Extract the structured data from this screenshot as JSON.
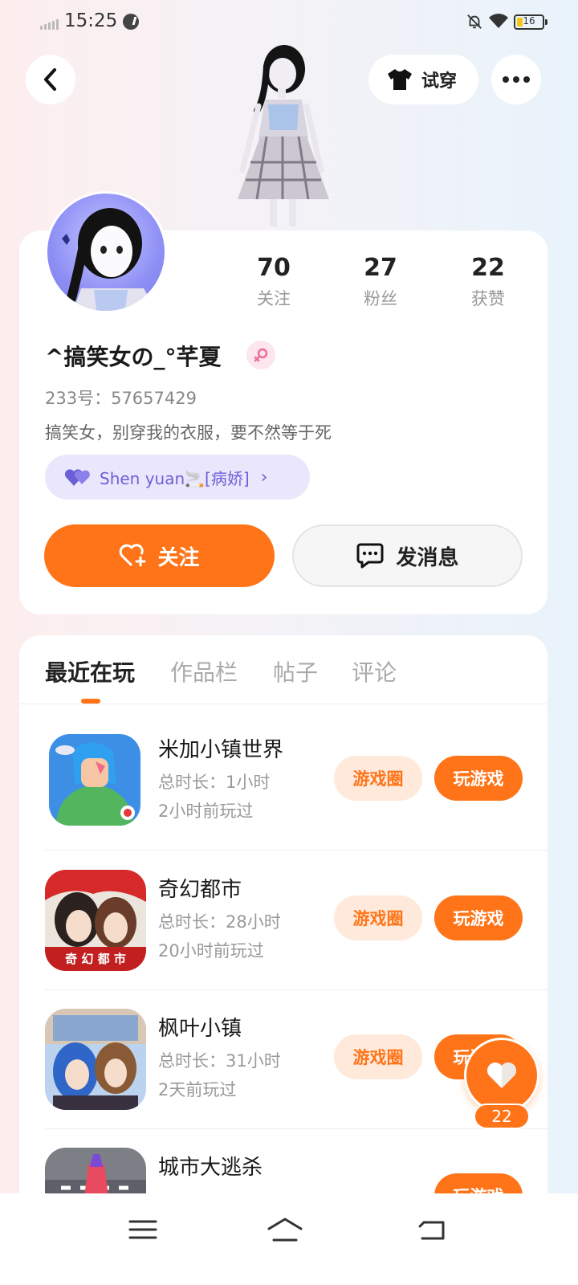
{
  "status_bar": {
    "time": "15:25",
    "battery": "16",
    "icons": [
      "signal-icon",
      "app-notification-icon",
      "bell-muted-icon",
      "wifi-icon",
      "battery-icon"
    ]
  },
  "header": {
    "tryon_label": "试穿",
    "icons": [
      "back-arrow-icon",
      "tshirt-icon",
      "more-icon"
    ]
  },
  "profile": {
    "stats": [
      {
        "value": "70",
        "label": "关注"
      },
      {
        "value": "27",
        "label": "粉丝"
      },
      {
        "value": "22",
        "label": "获赞"
      }
    ],
    "username": "^搞笑女の_°芊夏",
    "gender": "female",
    "uid": "233号：57657429",
    "bio": "搞笑女，别穿我的衣服，要不然等于死",
    "cp_text": "Shen yuan🚬[病娇]",
    "follow_label": "关注",
    "message_label": "发消息"
  },
  "tabs": [
    "最近在玩",
    "作品栏",
    "帖子",
    "评论"
  ],
  "games": [
    {
      "name": "米加小镇世界",
      "duration": "总时长：1小时",
      "last_played": "2小时前玩过",
      "circle_label": "游戏圈",
      "play_label": "玩游戏"
    },
    {
      "name": "奇幻都市",
      "duration": "总时长：28小时",
      "last_played": "20小时前玩过",
      "circle_label": "游戏圈",
      "play_label": "玩游戏",
      "icon_caption": "奇 幻 都 市"
    },
    {
      "name": "枫叶小镇",
      "duration": "总时长：31小时",
      "last_played": "2天前玩过",
      "circle_label": "游戏圈",
      "play_label": "玩游戏"
    },
    {
      "name": "城市大逃杀",
      "duration": "",
      "last_played": "",
      "circle_label": "",
      "play_label": "玩游戏"
    }
  ],
  "floating_like": {
    "count": "22"
  },
  "colors": {
    "accent": "#ff7418",
    "accent_light": "#ffe9db",
    "cp_purple": "#6b5fd6",
    "cp_bg": "#eae7fd"
  }
}
